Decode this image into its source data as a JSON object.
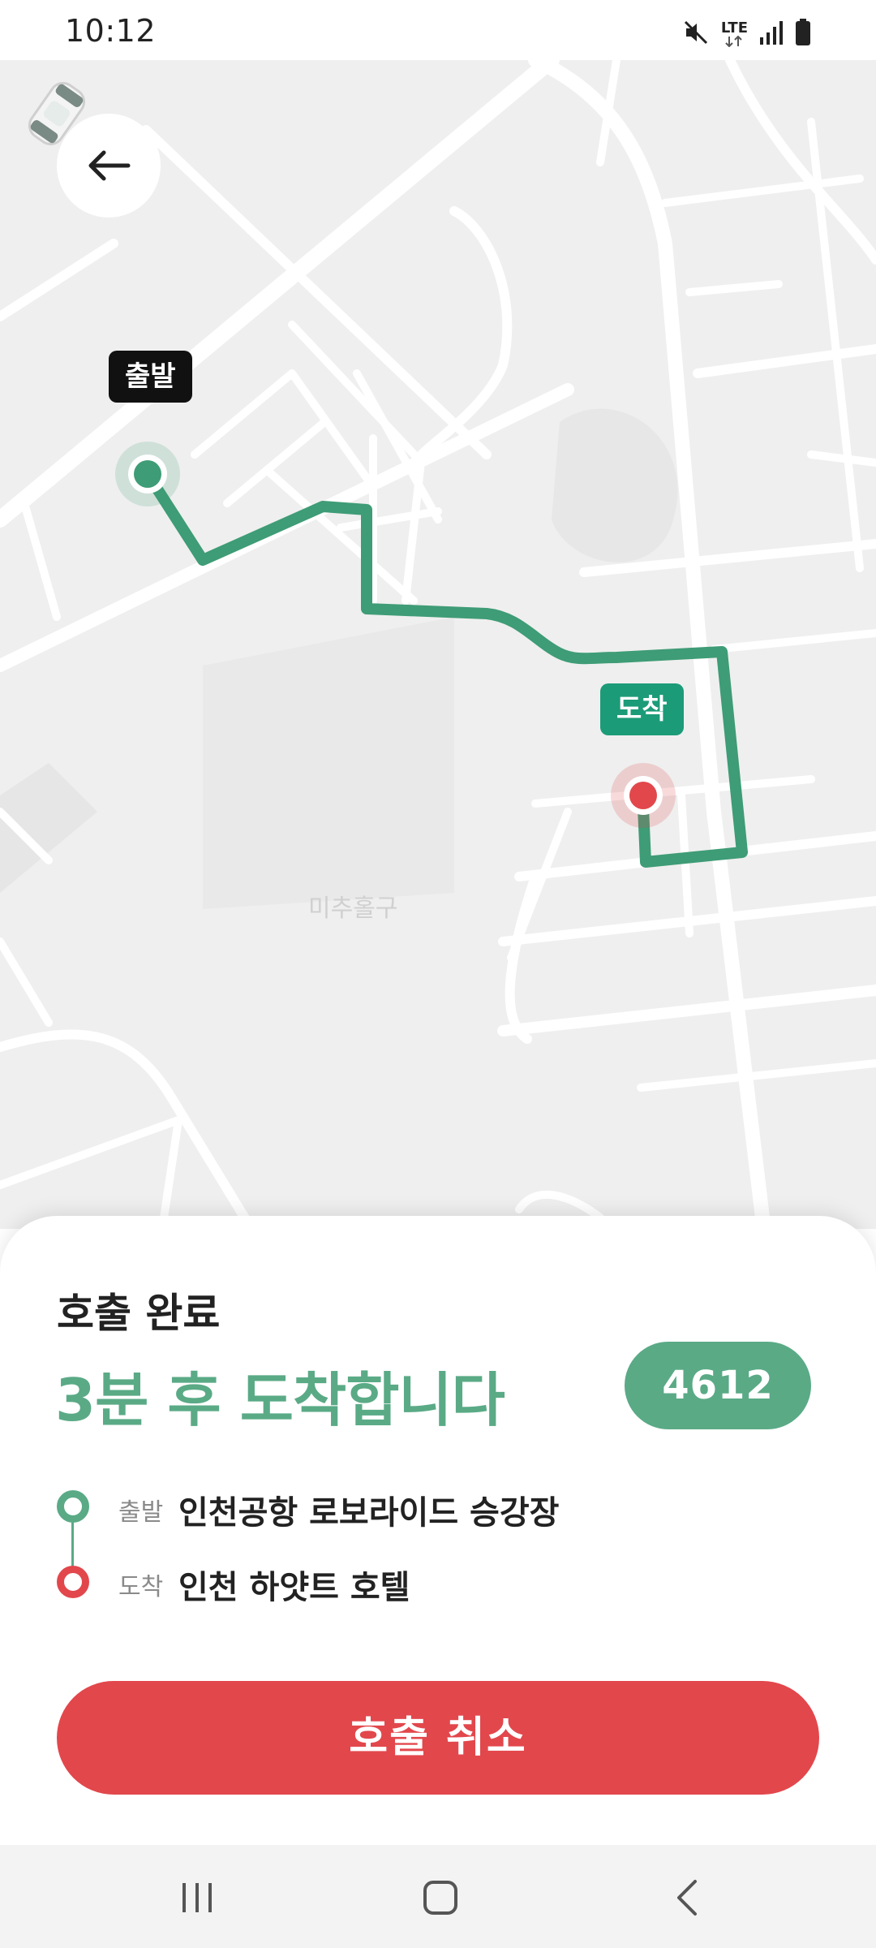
{
  "status_bar": {
    "time": "10:12",
    "network": "LTE",
    "icons": [
      "mute-icon",
      "lte-icon",
      "signal-icon",
      "battery-icon"
    ]
  },
  "map": {
    "district_label": "미추홀구",
    "start_pin_label": "출발",
    "end_pin_label": "도착"
  },
  "sheet": {
    "subtitle": "호출 완료",
    "title": "3분 후 도착합니다",
    "robot_number": "4612",
    "route": {
      "start_tag": "출발",
      "start_place": "인천공항 로보라이드 승강장",
      "end_tag": "도착",
      "end_place": "인천 하얏트 호텔"
    },
    "cancel_label": "호출 취소"
  },
  "nav_bar": {
    "icons": [
      "recent-apps-icon",
      "home-icon",
      "back-nav-icon"
    ]
  },
  "colors": {
    "accent_green": "#5aaa86",
    "route_green": "#3e9c76",
    "end_red": "#e2474c",
    "start_pin_black": "#111111",
    "end_pin_green": "#1c9b78"
  }
}
